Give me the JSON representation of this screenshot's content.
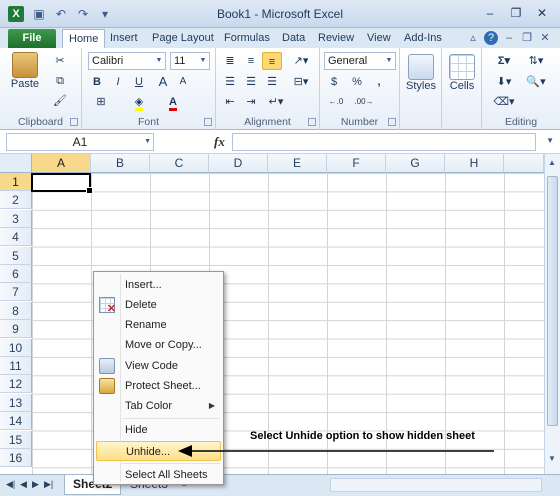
{
  "window": {
    "title": "Book1 - Microsoft Excel",
    "app_icon": "X",
    "qat_icons": [
      "save-icon",
      "undo-icon",
      "redo-icon",
      "customize-icon"
    ],
    "controls": [
      "minimize-icon",
      "restore-icon",
      "close-icon"
    ]
  },
  "tabs": [
    "File",
    "Home",
    "Insert",
    "Page Layout",
    "Formulas",
    "Data",
    "Review",
    "View",
    "Add-Ins"
  ],
  "active_tab": "Home",
  "ribbon": {
    "clipboard": {
      "label": "Clipboard",
      "paste_label": "Paste"
    },
    "font": {
      "label": "Font",
      "font_name": "Calibri",
      "font_size": "11",
      "bold": "B",
      "italic": "I",
      "underline": "U"
    },
    "alignment": {
      "label": "Alignment"
    },
    "number": {
      "label": "Number",
      "format": "General",
      "currency": "$",
      "percent": "%",
      "comma": ","
    },
    "styles": {
      "label": "Styles"
    },
    "cells": {
      "label": "Cells"
    },
    "editing": {
      "label": "Editing",
      "sum": "Σ"
    }
  },
  "formula_bar": {
    "name_box": "A1",
    "fx": "fx",
    "value": ""
  },
  "grid": {
    "columns": [
      "A",
      "B",
      "C",
      "D",
      "E",
      "F",
      "G",
      "H"
    ],
    "rows": [
      "1",
      "2",
      "3",
      "4",
      "5",
      "6",
      "7",
      "8",
      "9",
      "10",
      "11",
      "12",
      "13",
      "14",
      "15",
      "16"
    ],
    "active_cell": "A1"
  },
  "context_menu": {
    "items": [
      "Insert...",
      "Delete",
      "Rename",
      "Move or Copy...",
      "View Code",
      "Protect Sheet...",
      "Tab Color",
      "Hide",
      "Unhide...",
      "Select All Sheets"
    ],
    "highlighted": "Unhide..."
  },
  "annotation": "Select Unhide option to show hidden sheet",
  "sheets": {
    "active": "Sheet2",
    "other": "Sheet3"
  },
  "colors": {
    "file_tab": "#2e7d32",
    "highlight": "#fbd874",
    "selected_header": "#f8d88a"
  }
}
